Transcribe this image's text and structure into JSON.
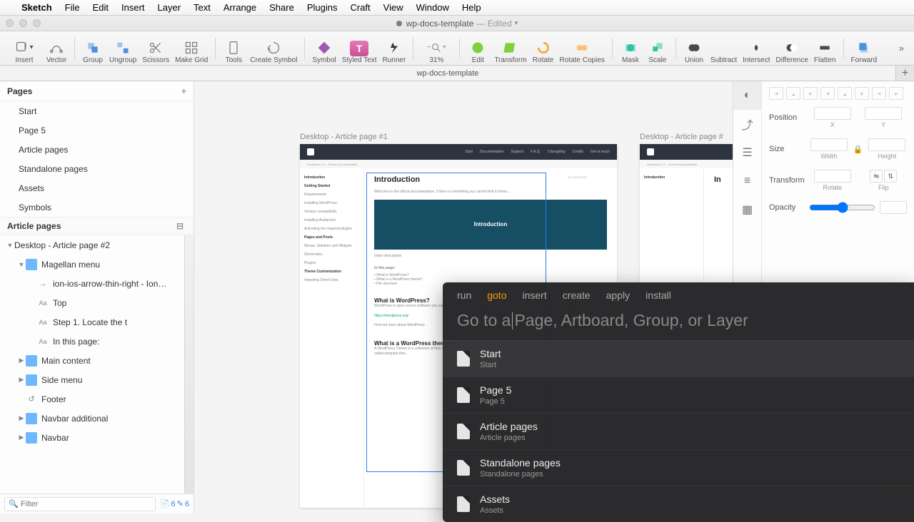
{
  "menubar": {
    "items": [
      "Sketch",
      "File",
      "Edit",
      "Insert",
      "Layer",
      "Text",
      "Arrange",
      "Share",
      "Plugins",
      "Craft",
      "View",
      "Window",
      "Help"
    ]
  },
  "title": {
    "filename": "wp-docs-template",
    "status": "Edited"
  },
  "toolbar": {
    "insert": "Insert",
    "vector": "Vector",
    "group": "Group",
    "ungroup": "Ungroup",
    "scissors": "Scissors",
    "makegrid": "Make Grid",
    "tools": "Tools",
    "createsymbol": "Create Symbol",
    "symbol": "Symbol",
    "styledtext": "Styled Text",
    "runner": "Runner",
    "zoom": "31%",
    "edit": "Edit",
    "transform": "Transform",
    "rotate": "Rotate",
    "rotatecopies": "Rotate Copies",
    "mask": "Mask",
    "scale": "Scale",
    "union": "Union",
    "subtract": "Subtract",
    "intersect": "Intersect",
    "difference": "Difference",
    "flatten": "Flatten",
    "forward": "Forward"
  },
  "tab": {
    "name": "wp-docs-template"
  },
  "pages": {
    "heading": "Pages",
    "items": [
      "Start",
      "Page 5",
      "Article pages",
      "Standalone pages",
      "Assets",
      "Symbols"
    ]
  },
  "layers": {
    "heading": "Article pages",
    "artboard": "Desktop - Article page #2",
    "groups": {
      "magellan": "Magellan menu",
      "arrow": "ion-ios-arrow-thin-right - Ion…",
      "top": "Top",
      "step1": "Step 1. Locate the t",
      "inpage": "In this page:",
      "main": "Main content",
      "sidemenu": "Side menu",
      "footer": "Footer",
      "navadd": "Navbar additional",
      "navbar": "Navbar"
    }
  },
  "filter": {
    "placeholder": "Filter",
    "count": "6"
  },
  "canvas": {
    "label1": "Desktop - Article page #1",
    "label2": "Desktop - Article page #",
    "nav": [
      "Start",
      "Documentation",
      "Support",
      "F.A.Q.",
      "Changelog",
      "Credits",
      "Get in touch"
    ],
    "sub": "Avalanche 1.2 – Theme Documentation",
    "h1": "Introduction",
    "video": "Introduction",
    "h2a": "What is WordPress?",
    "h2b": "What is a WordPress theme?",
    "inpage_t": "In this page:",
    "toc_t": "IN THIS PAGE",
    "side": {
      "intro": "Introduction",
      "getting": "Getting Started",
      "req": "Requirements",
      "wp": "Installing WordPress",
      "compat": "Version compatibility",
      "inst": "Installing Avalanche",
      "act": "Activating the required plugins",
      "pages": "Pages and Posts",
      "menus": "Menus, Sidebars and Widgets",
      "short": "Shortcodes",
      "plugins": "Plugins",
      "theme": "Theme Customization",
      "demo": "Importing Demo Data"
    }
  },
  "inspector": {
    "position": "Position",
    "x": "X",
    "y": "Y",
    "size": "Size",
    "w": "Width",
    "h": "Height",
    "transform": "Transform",
    "rot": "Rotate",
    "flip": "Flip",
    "opacity": "Opacity"
  },
  "runner": {
    "tabs": [
      "run",
      "goto",
      "insert",
      "create",
      "apply",
      "install"
    ],
    "active": "goto",
    "placeholder_a": "Go to a",
    "placeholder_b": "Page, Artboard, Group, or Layer",
    "items": [
      {
        "t": "Start",
        "s": "Start"
      },
      {
        "t": "Page 5",
        "s": "Page 5"
      },
      {
        "t": "Article pages",
        "s": "Article pages"
      },
      {
        "t": "Standalone pages",
        "s": "Standalone pages"
      },
      {
        "t": "Assets",
        "s": "Assets"
      }
    ]
  }
}
